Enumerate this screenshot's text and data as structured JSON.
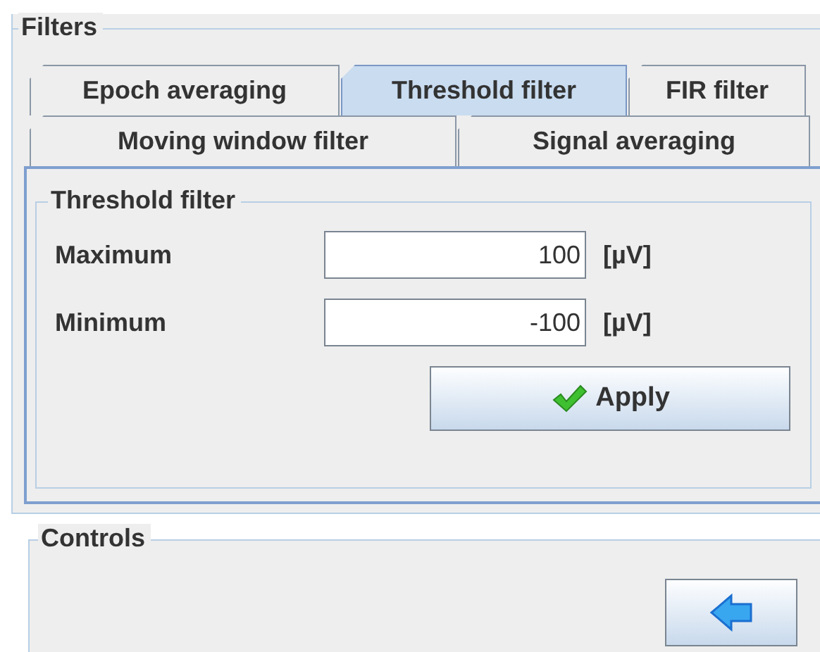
{
  "filters": {
    "legend": "Filters",
    "tab_rows": [
      [
        {
          "label": "Epoch averaging",
          "selected": false
        },
        {
          "label": "Threshold filter",
          "selected": true
        },
        {
          "label": "FIR filter",
          "selected": false
        }
      ],
      [
        {
          "label": "Moving window filter",
          "selected": false
        },
        {
          "label": "Signal averaging",
          "selected": false
        }
      ]
    ],
    "panel": {
      "legend": "Threshold filter",
      "fields": [
        {
          "label": "Maximum",
          "value": "100",
          "unit": "[µV]"
        },
        {
          "label": "Minimum",
          "value": "-100",
          "unit": "[µV]"
        }
      ],
      "apply_button": "Apply"
    }
  },
  "controls": {
    "legend": "Controls"
  }
}
